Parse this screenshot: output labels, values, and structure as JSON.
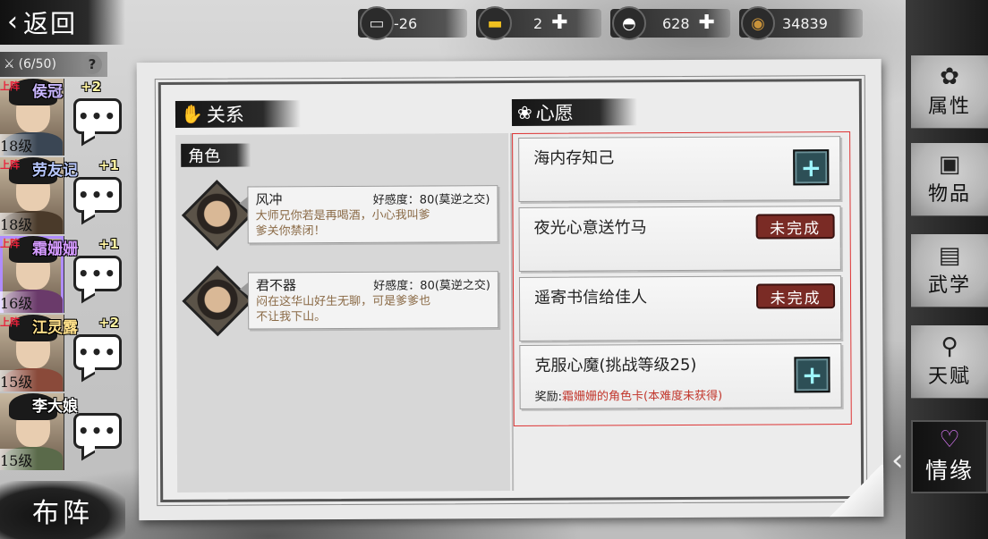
{
  "header": {
    "back_label": "返回",
    "resources": [
      {
        "icon": "scroll-icon",
        "value": "-26",
        "has_plus": false
      },
      {
        "icon": "gold-bar-icon",
        "value": "2",
        "has_plus": true
      },
      {
        "icon": "silver-ingot-icon",
        "value": "628",
        "has_plus": true
      },
      {
        "icon": "copper-coin-icon",
        "value": "34839",
        "has_plus": false
      }
    ]
  },
  "team": {
    "count": "(6/50)",
    "help": "?",
    "heroes": [
      {
        "tag": "上阵",
        "name": "侯冠",
        "bonus": "+2",
        "level": "18级",
        "chat": "•••",
        "name_color": "#c9b6ff"
      },
      {
        "tag": "上阵",
        "name": "劳友记",
        "bonus": "+1",
        "level": "18级",
        "chat": "•••",
        "name_color": "#b8c8ff"
      },
      {
        "tag": "上阵",
        "name": "霜姗姗",
        "bonus": "+1",
        "level": "16级",
        "chat": "•••",
        "name_color": "#d59bff"
      },
      {
        "tag": "上阵",
        "name": "江灵露",
        "bonus": "+2",
        "level": "15级",
        "chat": "•••",
        "name_color": "#ffe08a"
      },
      {
        "tag": "",
        "name": "李大娘",
        "bonus": "",
        "level": "15级",
        "chat": "•••",
        "name_color": "#ffffff"
      }
    ],
    "formation_label": "布阵"
  },
  "relations": {
    "title": "关系",
    "role_label": "角色",
    "cards": [
      {
        "name": "风冲",
        "affinity": "好感度：80(莫逆之交)",
        "line1": "大师兄你若是再喝酒，小心我叫爹",
        "line2": "爹关你禁闭！"
      },
      {
        "name": "君不器",
        "affinity": "好感度：80(莫逆之交)",
        "line1": "闷在这华山好生无聊，可是爹爹也",
        "line2": "不让我下山。"
      }
    ]
  },
  "wishes": {
    "title": "心愿",
    "items": [
      {
        "title": "海内存知己",
        "status": "",
        "action": "+",
        "reward_label": "",
        "reward_value": ""
      },
      {
        "title": "夜光心意送竹马",
        "status": "未完成",
        "action": "",
        "reward_label": "",
        "reward_value": ""
      },
      {
        "title": "遥寄书信给佳人",
        "status": "未完成",
        "action": "",
        "reward_label": "",
        "reward_value": ""
      },
      {
        "title": "克服心魔(挑战等级25)",
        "status": "",
        "action": "+",
        "reward_label": "奖励:",
        "reward_value": "霜姗姗的角色卡(本难度未获得)"
      }
    ]
  },
  "nav": {
    "items": [
      {
        "label": "属性",
        "icon": "flower-icon"
      },
      {
        "label": "物品",
        "icon": "gift-box-icon"
      },
      {
        "label": "武学",
        "icon": "book-icon"
      },
      {
        "label": "天赋",
        "icon": "constellation-icon"
      },
      {
        "label": "情缘",
        "icon": "heart-icon"
      }
    ],
    "active": "情缘"
  },
  "colors": {
    "wish_box_border": "#dd3333",
    "status_bg": "#7a2b25",
    "reward_value": "#c2362c",
    "affinity_text": "#8a6a46"
  }
}
